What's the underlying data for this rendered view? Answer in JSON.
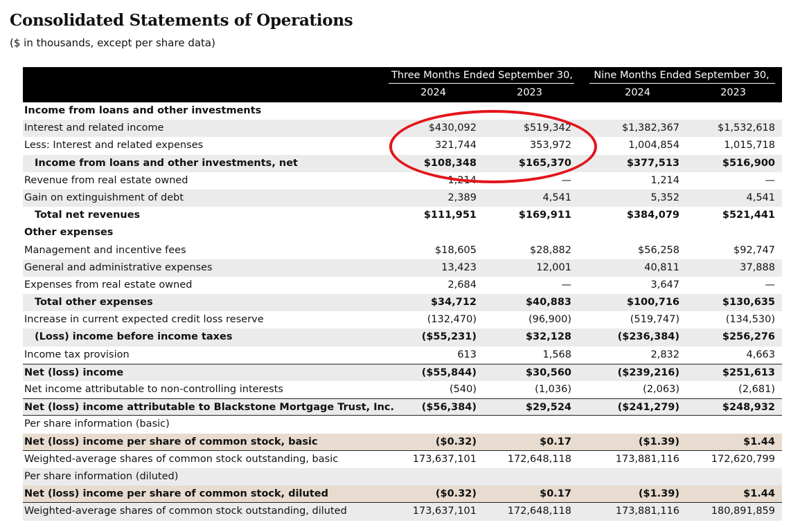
{
  "document": {
    "title": "Consolidated Statements of Operations",
    "subtitle": "($ in thousands, except per share data)"
  },
  "header": {
    "groups": [
      "Three Months Ended September 30,",
      "Nine Months Ended September 30,"
    ],
    "years": [
      "2024",
      "2023",
      "2024",
      "2023"
    ]
  },
  "annotation": {
    "color": "#e4141b",
    "shape": "red-ellipse-highlight"
  },
  "rows": [
    {
      "label": "Income from loans and other investments",
      "values": [
        "",
        "",
        "",
        ""
      ]
    },
    {
      "label": "Interest and related income",
      "values": [
        "$430,092",
        "$519,342",
        "$1,382,367",
        "$1,532,618"
      ]
    },
    {
      "label": "Less: Interest and related expenses",
      "values": [
        "321,744",
        "353,972",
        "1,004,854",
        "1,015,718"
      ]
    },
    {
      "label": "Income from loans and other investments, net",
      "values": [
        "$108,348",
        "$165,370",
        "$377,513",
        "$516,900"
      ]
    },
    {
      "label": "Revenue from real estate owned",
      "values": [
        "1,214",
        "—",
        "1,214",
        "—"
      ]
    },
    {
      "label": "Gain on extinguishment of debt",
      "values": [
        "2,389",
        "4,541",
        "5,352",
        "4,541"
      ]
    },
    {
      "label": "Total net revenues",
      "values": [
        "$111,951",
        "$169,911",
        "$384,079",
        "$521,441"
      ]
    },
    {
      "label": "Other expenses",
      "values": [
        "",
        "",
        "",
        ""
      ]
    },
    {
      "label": "Management and incentive fees",
      "values": [
        "$18,605",
        "$28,882",
        "$56,258",
        "$92,747"
      ]
    },
    {
      "label": "General and administrative expenses",
      "values": [
        "13,423",
        "12,001",
        "40,811",
        "37,888"
      ]
    },
    {
      "label": "Expenses from real estate owned",
      "values": [
        "2,684",
        "—",
        "3,647",
        "—"
      ]
    },
    {
      "label": "Total other expenses",
      "values": [
        "$34,712",
        "$40,883",
        "$100,716",
        "$130,635"
      ]
    },
    {
      "label": "Increase in current expected credit loss reserve",
      "values": [
        "(132,470)",
        "(96,900)",
        "(519,747)",
        "(134,530)"
      ]
    },
    {
      "label": "(Loss) income before income taxes",
      "values": [
        "($55,231)",
        "$32,128",
        "($236,384)",
        "$256,276"
      ]
    },
    {
      "label": "Income tax provision",
      "values": [
        "613",
        "1,568",
        "2,832",
        "4,663"
      ]
    },
    {
      "label": "Net (loss) income",
      "values": [
        "($55,844)",
        "$30,560",
        "($239,216)",
        "$251,613"
      ]
    },
    {
      "label": "Net income attributable to non-controlling interests",
      "values": [
        "(540)",
        "(1,036)",
        "(2,063)",
        "(2,681)"
      ]
    },
    {
      "label": "Net (loss) income attributable to Blackstone Mortgage Trust, Inc.",
      "values": [
        "($56,384)",
        "$29,524",
        "($241,279)",
        "$248,932"
      ]
    },
    {
      "label": "Per share information (basic)",
      "values": [
        "",
        "",
        "",
        ""
      ]
    },
    {
      "label": "Net (loss) income per share of common stock, basic",
      "values": [
        "($0.32)",
        "$0.17",
        "($1.39)",
        "$1.44"
      ]
    },
    {
      "label": "Weighted-average shares of common stock outstanding, basic",
      "values": [
        "173,637,101",
        "172,648,118",
        "173,881,116",
        "172,620,799"
      ]
    },
    {
      "label": "Per share information (diluted)",
      "values": [
        "",
        "",
        "",
        ""
      ]
    },
    {
      "label": "Net (loss) income per share of common stock, diluted",
      "values": [
        "($0.32)",
        "$0.17",
        "($1.39)",
        "$1.44"
      ]
    },
    {
      "label": "Weighted-average shares of common stock outstanding, diluted",
      "values": [
        "173,637,101",
        "172,648,118",
        "173,881,116",
        "180,891,859"
      ]
    }
  ]
}
